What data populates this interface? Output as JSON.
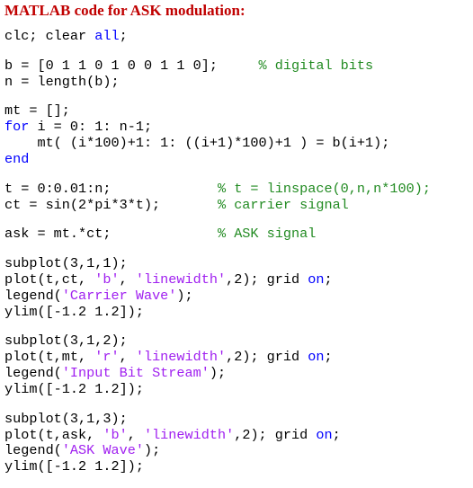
{
  "heading": "MATLAB code for ASK modulation:",
  "colors": {
    "heading": "#c00000",
    "code_text": "#000000",
    "keyword": "#0000ff",
    "string": "#a020f0",
    "comment": "#228b22"
  },
  "code": [
    [
      {
        "t": "clc; clear ",
        "k": "txt"
      },
      {
        "t": "all",
        "k": "kw"
      },
      {
        "t": ";",
        "k": "txt"
      }
    ],
    [],
    [
      {
        "t": "b = [0 1 1 0 1 0 0 1 1 0];     ",
        "k": "txt"
      },
      {
        "t": "% digital bits",
        "k": "cmt"
      }
    ],
    [
      {
        "t": "n = length(b);",
        "k": "txt"
      }
    ],
    [],
    [
      {
        "t": "mt = [];",
        "k": "txt"
      }
    ],
    [
      {
        "t": "for",
        "k": "kw"
      },
      {
        "t": " i = 0: 1: n-1;",
        "k": "txt"
      }
    ],
    [
      {
        "t": "    mt( (i*100)+1: 1: ((i+1)*100)+1 ) = b(i+1);",
        "k": "txt"
      }
    ],
    [
      {
        "t": "end",
        "k": "kw"
      }
    ],
    [],
    [
      {
        "t": "t = 0:0.01:n;             ",
        "k": "txt"
      },
      {
        "t": "% t = linspace(0,n,n*100);",
        "k": "cmt"
      }
    ],
    [
      {
        "t": "ct = sin(2*pi*3*t);       ",
        "k": "txt"
      },
      {
        "t": "% carrier signal",
        "k": "cmt"
      }
    ],
    [],
    [
      {
        "t": "ask = mt.*ct;             ",
        "k": "txt"
      },
      {
        "t": "% ASK signal",
        "k": "cmt"
      }
    ],
    [],
    [
      {
        "t": "subplot(3,1,1);",
        "k": "txt"
      }
    ],
    [
      {
        "t": "plot(t,ct, ",
        "k": "txt"
      },
      {
        "t": "'b'",
        "k": "str"
      },
      {
        "t": ", ",
        "k": "txt"
      },
      {
        "t": "'linewidth'",
        "k": "str"
      },
      {
        "t": ",2); grid ",
        "k": "txt"
      },
      {
        "t": "on",
        "k": "kw"
      },
      {
        "t": ";",
        "k": "txt"
      }
    ],
    [
      {
        "t": "legend(",
        "k": "txt"
      },
      {
        "t": "'Carrier Wave'",
        "k": "str"
      },
      {
        "t": ");",
        "k": "txt"
      }
    ],
    [
      {
        "t": "ylim([-1.2 1.2]);",
        "k": "txt"
      }
    ],
    [],
    [
      {
        "t": "subplot(3,1,2);",
        "k": "txt"
      }
    ],
    [
      {
        "t": "plot(t,mt, ",
        "k": "txt"
      },
      {
        "t": "'r'",
        "k": "str"
      },
      {
        "t": ", ",
        "k": "txt"
      },
      {
        "t": "'linewidth'",
        "k": "str"
      },
      {
        "t": ",2); grid ",
        "k": "txt"
      },
      {
        "t": "on",
        "k": "kw"
      },
      {
        "t": ";",
        "k": "txt"
      }
    ],
    [
      {
        "t": "legend(",
        "k": "txt"
      },
      {
        "t": "'Input Bit Stream'",
        "k": "str"
      },
      {
        "t": ");",
        "k": "txt"
      }
    ],
    [
      {
        "t": "ylim([-1.2 1.2]);",
        "k": "txt"
      }
    ],
    [],
    [
      {
        "t": "subplot(3,1,3);",
        "k": "txt"
      }
    ],
    [
      {
        "t": "plot(t,ask, ",
        "k": "txt"
      },
      {
        "t": "'b'",
        "k": "str"
      },
      {
        "t": ", ",
        "k": "txt"
      },
      {
        "t": "'linewidth'",
        "k": "str"
      },
      {
        "t": ",2); grid ",
        "k": "txt"
      },
      {
        "t": "on",
        "k": "kw"
      },
      {
        "t": ";",
        "k": "txt"
      }
    ],
    [
      {
        "t": "legend(",
        "k": "txt"
      },
      {
        "t": "'ASK Wave'",
        "k": "str"
      },
      {
        "t": ");",
        "k": "txt"
      }
    ],
    [
      {
        "t": "ylim([-1.2 1.2]);",
        "k": "txt"
      }
    ]
  ]
}
